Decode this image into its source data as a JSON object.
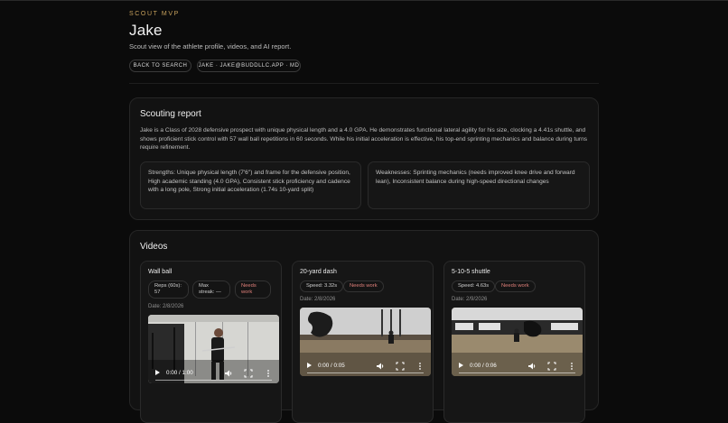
{
  "header": {
    "eyebrow": "SCOUT MVP",
    "title": "Jake",
    "subtitle": "Scout view of the athlete profile, videos, and AI report.",
    "back_label": "BACK TO SEARCH",
    "user_label": "JAKE · JAKE@BUDDLLC.APP · MD"
  },
  "report": {
    "title": "Scouting report",
    "summary": "Jake is a Class of 2028 defensive prospect with unique physical length and a 4.0 GPA. He demonstrates functional lateral agility for his size, clocking a 4.41s shuttle, and shows proficient stick control with 57 wall ball repetitions in 60 seconds. While his initial acceleration is effective, his top-end sprinting mechanics and balance during turns require refinement.",
    "strengths": "Strengths: Unique physical length (7'6\") and frame for the defensive position, High academic standing (4.0 GPA), Consistent stick proficiency and cadence with a long pole, Strong initial acceleration (1.74s 10-yard split)",
    "weaknesses": "Weaknesses: Sprinting mechanics (needs improved knee drive and forward lean), Inconsistent balance during high-speed directional changes"
  },
  "videos": {
    "title": "Videos",
    "items": [
      {
        "title": "Wall ball",
        "tags": [
          "Reps (60s): 57",
          "Max streak: —",
          "Needs work"
        ],
        "date": "Date: 2/8/2026",
        "time": "0:00 / 1:00"
      },
      {
        "title": "20-yard dash",
        "tags": [
          "Speed: 3.32s",
          "Needs work"
        ],
        "date": "Date: 2/8/2026",
        "time": "0:00 / 0:05"
      },
      {
        "title": "5-10-5 shuttle",
        "tags": [
          "Speed: 4.63s",
          "Needs work"
        ],
        "date": "Date: 2/9/2026",
        "time": "0:00 / 0:06"
      }
    ]
  },
  "colors": {
    "accent": "#c7a15c",
    "warn": "#e0807a",
    "background": "#0b0b0b"
  }
}
